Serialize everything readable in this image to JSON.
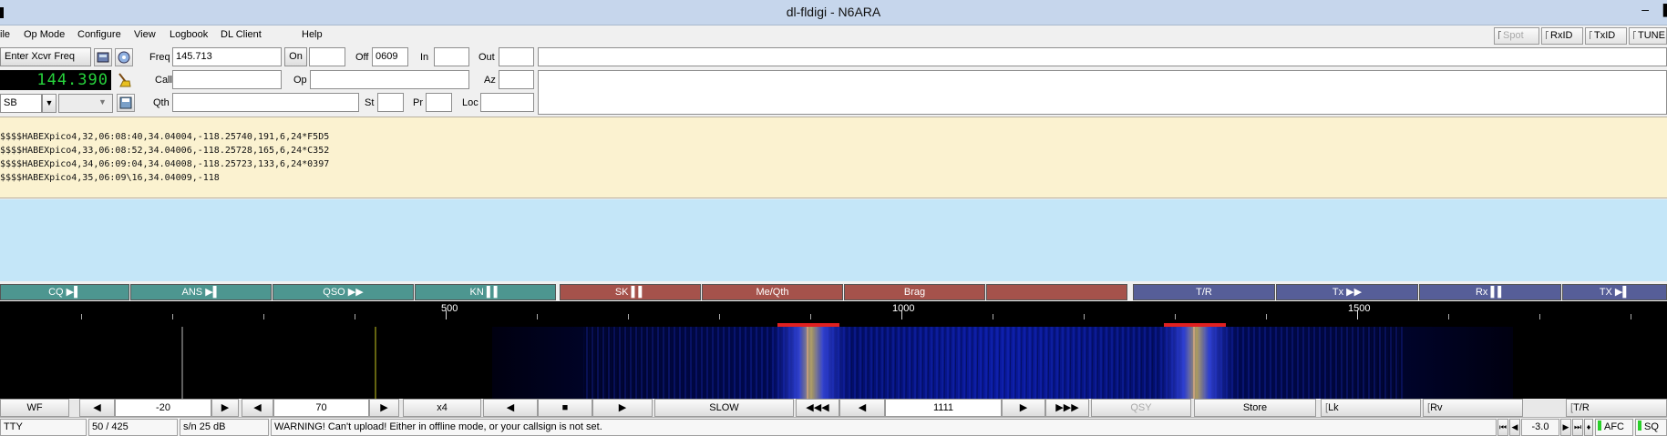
{
  "window": {
    "title": "dl-fldigi - N6ARA"
  },
  "menu": {
    "items": [
      "ile",
      "Op Mode",
      "Configure",
      "View",
      "Logbook",
      "DL Client",
      "Help"
    ],
    "toggles": {
      "spot": "Spot",
      "rxid": "RxID",
      "txid": "TxID",
      "tune": "TUNE"
    }
  },
  "log": {
    "xcvr_freq_label": "Enter Xcvr Freq",
    "freq_display": "144.390",
    "mode": "SB",
    "freq_label": "Freq",
    "freq_value": "145.713",
    "on_label": "On",
    "on_value": "",
    "off_label": "Off",
    "off_value": "0609",
    "in_label": "In",
    "out_label": "Out",
    "call_label": "Call",
    "op_label": "Op",
    "az_label": "Az",
    "qth_label": "Qth",
    "st_label": "St",
    "pr_label": "Pr",
    "loc_label": "Loc"
  },
  "rx_text": [
    "$$$$HABEXpico4,32,06:08:40,34.04004,-118.25740,191,6,24*F5D5",
    "$$$$HABEXpico4,33,06:08:52,34.04006,-118.25728,165,6,24*C352",
    "$$$$HABEXpico4,34,06:09:04,34.04008,-118.25723,133,6,24*0397",
    "$$$$HABEXpico4,35,06:09\\16,34.04009,-118"
  ],
  "macros": [
    {
      "label": "CQ ▶▌",
      "color": "teal"
    },
    {
      "label": "ANS ▶▌",
      "color": "teal"
    },
    {
      "label": "QSO ▶▶",
      "color": "teal"
    },
    {
      "label": "KN ▌▌",
      "color": "teal"
    },
    {
      "label": "SK ▌▌",
      "color": "red"
    },
    {
      "label": "Me/Qth",
      "color": "red"
    },
    {
      "label": "Brag",
      "color": "red"
    },
    {
      "label": "",
      "color": "red"
    },
    {
      "label": "T/R",
      "color": "blue"
    },
    {
      "label": "Tx ▶▶",
      "color": "blue"
    },
    {
      "label": "Rx ▌▌",
      "color": "blue"
    },
    {
      "label": "TX ▶▌",
      "color": "blue"
    }
  ],
  "scale": {
    "labels": [
      "500",
      "1000",
      "1500"
    ]
  },
  "wf_controls": {
    "wf_label": "WF",
    "ref_level": "-20",
    "ampl_span": "70",
    "zoom": "x4",
    "speed": "SLOW",
    "carrier_freq": "1111",
    "qsy": "QSY",
    "store": "Store",
    "lk": "Lk",
    "rv": "Rv",
    "tr": "T/R"
  },
  "status": {
    "mode": "TTY",
    "count": "50  / 425",
    "sn": "s/n  25 dB",
    "message": "WARNING! Can't upload! Either in offline mode, or your callsign is not set.",
    "offset": "-3.0",
    "afc": "AFC",
    "sq": "SQ"
  },
  "colors": {
    "rx_bg": "#fbf2d0",
    "tx_bg": "#c4e6f8",
    "macro_teal": "#4d9690",
    "macro_red": "#a5524b",
    "macro_blue": "#565e98",
    "freq_digits": "#27d23c"
  }
}
